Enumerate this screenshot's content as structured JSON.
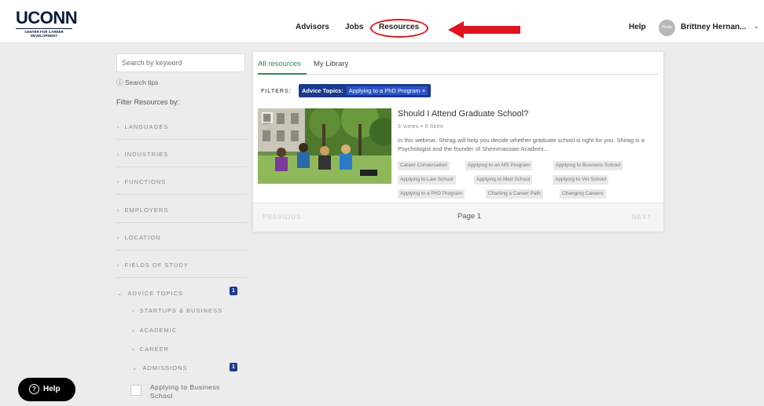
{
  "logo": {
    "main": "UCONN",
    "sub": "CENTER FOR CAREER DEVELOPMENT"
  },
  "nav": {
    "advisors": "Advisors",
    "jobs": "Jobs",
    "resources": "Resources",
    "help": "Help",
    "user": "Brittney Hernan...",
    "avatar_text": "Photo"
  },
  "colors": {
    "brand": "#0a1b3d",
    "accent_green": "#2e8b57",
    "chip_blue": "#1b3a8c",
    "annotation_red": "#d71920"
  },
  "sidebar": {
    "search_placeholder": "Search by keyword",
    "search_tips": "Search tips",
    "filter_label": "Filter Resources by:",
    "facets": [
      "LANGUAGES",
      "INDUSTRIES",
      "FUNCTIONS",
      "EMPLOYERS",
      "LOCATION",
      "FIELDS OF STUDY",
      "ADVICE TOPICS"
    ],
    "advice_badge": "1",
    "sub_facets": [
      "STARTUPS & BUSINESS",
      "ACADEMIC",
      "CAREER",
      "ADMISSIONS"
    ],
    "admissions_badge": "1",
    "checkbox_label": "Applying to Business School"
  },
  "help_pill": {
    "label": "Help",
    "icon": "question-icon"
  },
  "main": {
    "tabs": {
      "all": "All resources",
      "library": "My Library"
    },
    "filters_label": "FILTERS:",
    "chip": {
      "key": "Advice Topics:",
      "value": "Applying to a PhD Program",
      "close": "×"
    },
    "resource": {
      "title": "Should I Attend Graduate School?",
      "meta": "3 views  •  0 likes",
      "description": "In this webinar, Shirag will help you decide whether graduate school is right for you. Shirag is a Psychologist and the founder of Shemmassian Academi...",
      "tags": [
        "Career Conversation",
        "Applying to an MS Program",
        "Applying to Business School",
        "Applying to Law School",
        "Applying to Med School",
        "Applying to Vet School",
        "Applying to a PhD Program",
        "Charting a Career Path",
        "Changing Careers"
      ]
    },
    "pager": {
      "prev": "PREVIOUS",
      "page": "Page 1",
      "next": "NEXT"
    }
  }
}
